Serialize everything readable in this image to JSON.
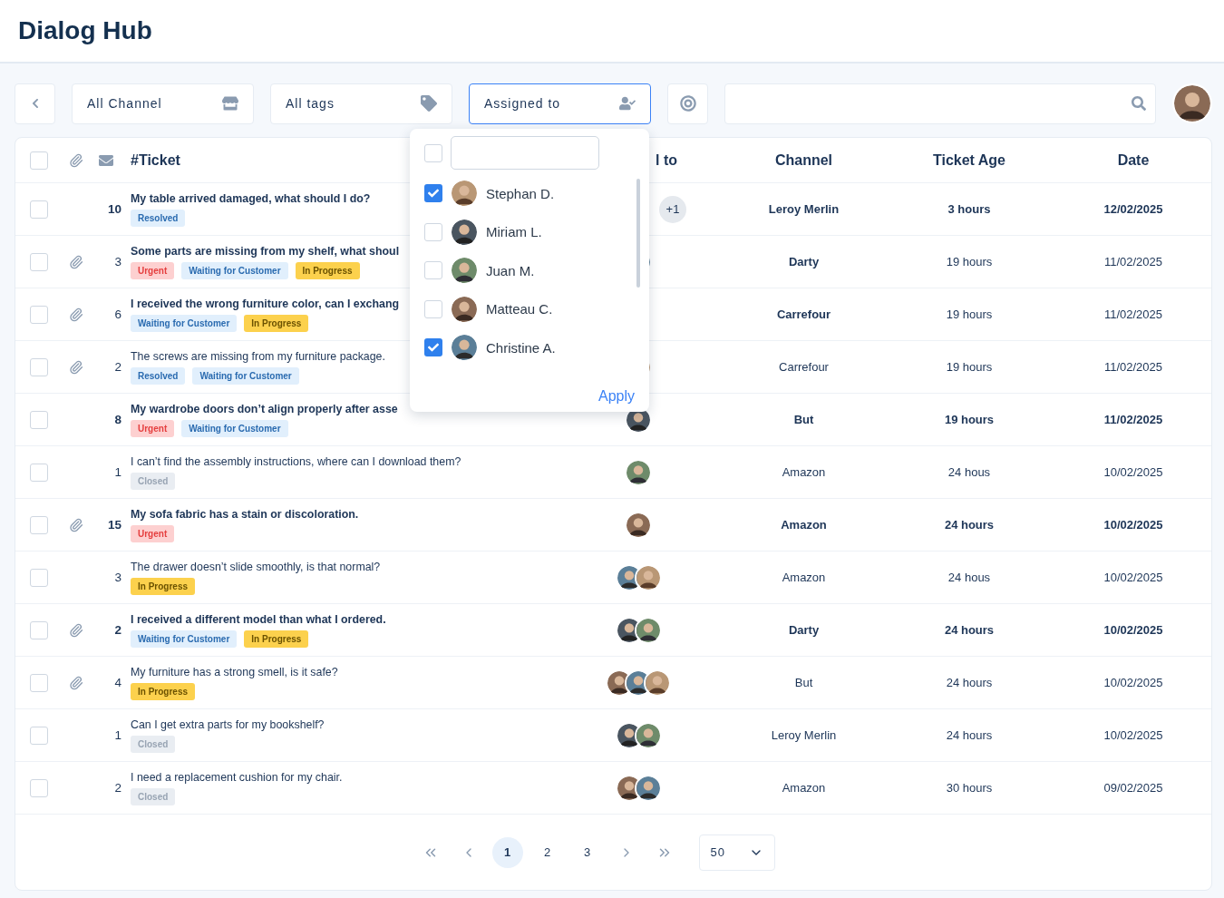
{
  "header": {
    "title": "Dialog Hub"
  },
  "filters": {
    "channel": "All Channel",
    "tags": "All tags",
    "assigned": "Assigned to",
    "assigned_open": true
  },
  "assignee_menu": {
    "select_all": false,
    "apply": "Apply",
    "people": [
      {
        "name": "Stephan D.",
        "checked": true
      },
      {
        "name": "Miriam L.",
        "checked": false
      },
      {
        "name": "Juan M.",
        "checked": false
      },
      {
        "name": "Matteau C.",
        "checked": false
      },
      {
        "name": "Christine A.",
        "checked": true
      }
    ]
  },
  "table": {
    "select_all": false,
    "columns": {
      "ticket": "#Ticket",
      "column_5": "l to",
      "channel": "Channel",
      "age": "Ticket Age",
      "date": "Date"
    },
    "rows": [
      {
        "checked": false,
        "attachment": false,
        "number": "10",
        "subject": "My table arrived damaged, what should I do?",
        "unread": true,
        "recent": true,
        "tags": [
          {
            "kind": "resolved",
            "label": "Resolved"
          }
        ],
        "assignees": [],
        "more": "+1",
        "channel": "Leroy Merlin",
        "age": "3 hours",
        "date": "12/02/2025"
      },
      {
        "checked": false,
        "attachment": true,
        "number": "3",
        "subject": "Some parts are missing from my shelf, what shoul",
        "unread": true,
        "recent": false,
        "tags": [
          {
            "kind": "urgent",
            "label": "Urgent"
          },
          {
            "kind": "waiting",
            "label": "Waiting for Customer"
          },
          {
            "kind": "progress",
            "label": "In Progress"
          }
        ],
        "assignees": [
          {
            "kind": "picture"
          }
        ],
        "channel": "Darty",
        "age": "19 hours",
        "date": "11/02/2025"
      },
      {
        "checked": false,
        "attachment": true,
        "number": "6",
        "subject": "I received the wrong furniture color, can I exchang",
        "unread": true,
        "recent": false,
        "tags": [
          {
            "kind": "waiting",
            "label": "Waiting for Customer"
          },
          {
            "kind": "progress",
            "label": "In Progress"
          }
        ],
        "assignees": [],
        "channel": "Carrefour",
        "age": "19 hours",
        "date": "11/02/2025"
      },
      {
        "checked": false,
        "attachment": true,
        "number": "2",
        "subject": "The screws are missing from my furniture package.",
        "unread": false,
        "recent": false,
        "tags": [
          {
            "kind": "resolved",
            "label": "Resolved"
          },
          {
            "kind": "waiting",
            "label": "Waiting for Customer"
          }
        ],
        "assignees": [
          {
            "kind": "picture"
          }
        ],
        "channel": "Carrefour",
        "age": "19 hours",
        "date": "11/02/2025"
      },
      {
        "checked": false,
        "attachment": false,
        "number": "8",
        "subject": "My wardrobe doors don’t align properly after asse",
        "unread": true,
        "recent": true,
        "tags": [
          {
            "kind": "urgent",
            "label": "Urgent"
          },
          {
            "kind": "waiting",
            "label": "Waiting for Customer"
          }
        ],
        "assignees": [
          {
            "kind": "picture"
          }
        ],
        "channel": "But",
        "age": "19 hours",
        "date": "11/02/2025"
      },
      {
        "checked": false,
        "attachment": false,
        "number": "1",
        "subject": "I can’t find the assembly instructions, where can I download them?",
        "unread": false,
        "recent": false,
        "tags": [
          {
            "kind": "closed",
            "label": "Closed"
          }
        ],
        "assignees": [
          {
            "kind": "picture"
          }
        ],
        "channel": "Amazon",
        "age": "24 hous",
        "date": "10/02/2025"
      },
      {
        "checked": false,
        "attachment": true,
        "number": "15",
        "subject": "My sofa fabric has a stain or discoloration.",
        "unread": true,
        "recent": true,
        "tags": [
          {
            "kind": "urgent",
            "label": "Urgent"
          }
        ],
        "assignees": [
          {
            "kind": "picture"
          }
        ],
        "channel": "Amazon",
        "age": "24 hours",
        "date": "10/02/2025"
      },
      {
        "checked": false,
        "attachment": false,
        "number": "3",
        "subject": "The drawer doesn’t slide smoothly, is that normal?",
        "unread": false,
        "recent": false,
        "tags": [
          {
            "kind": "progress",
            "label": "In Progress"
          }
        ],
        "assignees": [
          {
            "kind": "picture"
          },
          {
            "kind": "picture"
          }
        ],
        "channel": "Amazon",
        "age": "24 hous",
        "date": "10/02/2025"
      },
      {
        "checked": false,
        "attachment": true,
        "number": "2",
        "subject": "I received a different model than what I ordered.",
        "unread": true,
        "recent": true,
        "tags": [
          {
            "kind": "waiting",
            "label": "Waiting for Customer"
          },
          {
            "kind": "progress",
            "label": "In Progress"
          }
        ],
        "assignees": [
          {
            "kind": "picture"
          },
          {
            "kind": "picture"
          }
        ],
        "channel": "Darty",
        "age": "24 hours",
        "date": "10/02/2025"
      },
      {
        "checked": false,
        "attachment": true,
        "number": "4",
        "subject": "My furniture has a strong smell, is it safe?",
        "unread": false,
        "recent": false,
        "tags": [
          {
            "kind": "progress",
            "label": "In Progress"
          }
        ],
        "assignees": [
          {
            "kind": "picture"
          },
          {
            "kind": "picture"
          },
          {
            "kind": "picture"
          }
        ],
        "channel": "But",
        "age": "24 hours",
        "date": "10/02/2025"
      },
      {
        "checked": false,
        "attachment": false,
        "number": "1",
        "subject": "Can I get extra parts for my bookshelf?",
        "unread": false,
        "recent": false,
        "tags": [
          {
            "kind": "closed",
            "label": "Closed"
          }
        ],
        "assignees": [
          {
            "kind": "picture"
          },
          {
            "kind": "picture"
          }
        ],
        "channel": "Leroy Merlin",
        "age": "24 hours",
        "date": "10/02/2025"
      },
      {
        "checked": false,
        "attachment": false,
        "number": "2",
        "subject": "I need a replacement cushion for my chair.",
        "unread": false,
        "recent": false,
        "tags": [
          {
            "kind": "closed",
            "label": "Closed"
          }
        ],
        "assignees": [
          {
            "kind": "picture"
          },
          {
            "kind": "picture"
          }
        ],
        "channel": "Amazon",
        "age": "30 hours",
        "date": "09/02/2025"
      }
    ]
  },
  "pagination": {
    "pages": [
      {
        "label": "1",
        "selected": true
      },
      {
        "label": "2",
        "selected": false
      },
      {
        "label": "3",
        "selected": false
      }
    ],
    "page_size": "50"
  }
}
